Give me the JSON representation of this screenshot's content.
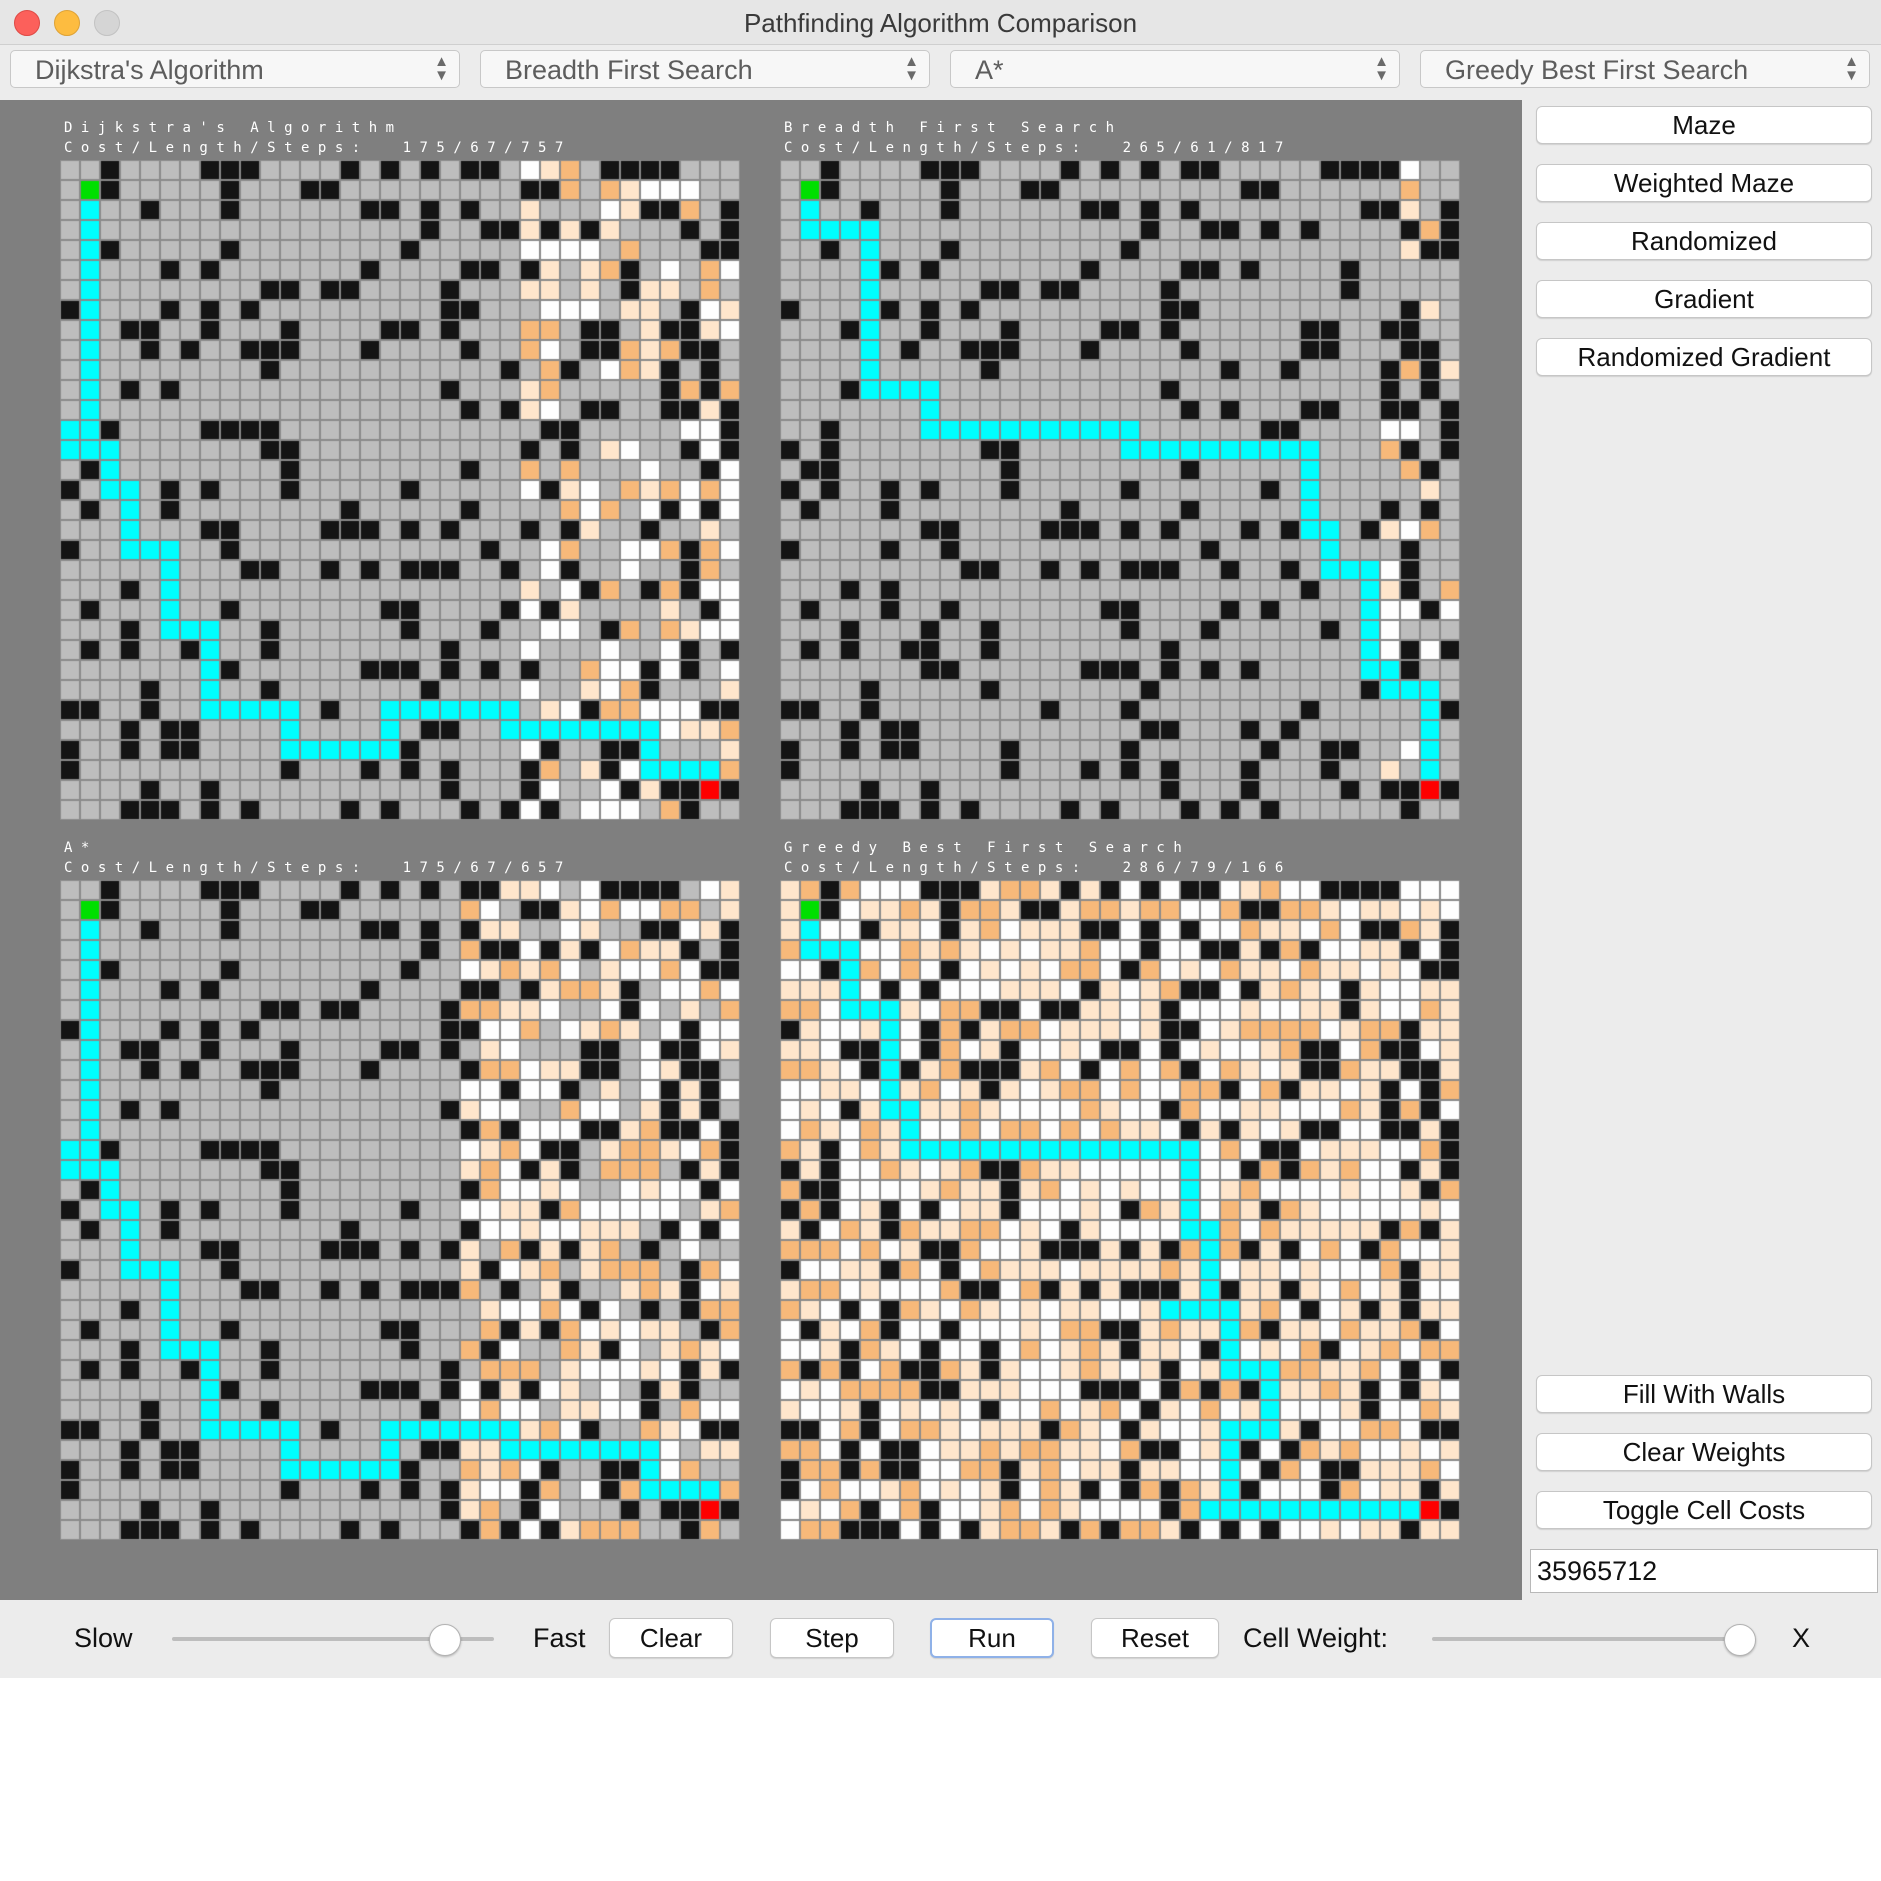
{
  "window": {
    "title": "Pathfinding Algorithm Comparison"
  },
  "selectors": [
    {
      "value": "Dijkstra's Algorithm"
    },
    {
      "value": "Breadth First Search"
    },
    {
      "value": "A*"
    },
    {
      "value": "Greedy Best First Search"
    }
  ],
  "panels": [
    {
      "name": "Dijkstra's Algorithm",
      "stats_label": "Cost/Length/Steps:",
      "stats": "175/67/757"
    },
    {
      "name": "Breadth First Search",
      "stats_label": "Cost/Length/Steps:",
      "stats": "265/61/817"
    },
    {
      "name": "A*",
      "stats_label": "Cost/Length/Steps:",
      "stats": "175/67/657"
    },
    {
      "name": "Greedy Best First Search",
      "stats_label": "Cost/Length/Steps:",
      "stats": "286/79/166"
    }
  ],
  "sidebar": {
    "top_buttons": [
      "Maze",
      "Weighted Maze",
      "Randomized",
      "Gradient",
      "Randomized Gradient"
    ],
    "bottom_buttons": [
      "Fill With Walls",
      "Clear Weights",
      "Toggle Cell Costs"
    ],
    "seed_value": "35965712"
  },
  "controls": {
    "speed_slow_label": "Slow",
    "speed_fast_label": "Fast",
    "speed_level": 0.88,
    "clear_label": "Clear",
    "step_label": "Step",
    "run_label": "Run",
    "reset_label": "Reset",
    "cell_weight_label": "Cell Weight:",
    "cell_weight_level": 1.0,
    "x_label": "X"
  },
  "colors": {
    "wall": "#141414",
    "empty": "#bdbdbd",
    "path": "#00ffff",
    "start": "#00e000",
    "goal": "#ff0000",
    "visited_light": "#ffffff",
    "visited_mid": "#ffe6cc",
    "visited_dark": "#f7b97a"
  },
  "grid": {
    "rows": 33,
    "cols": 34
  }
}
